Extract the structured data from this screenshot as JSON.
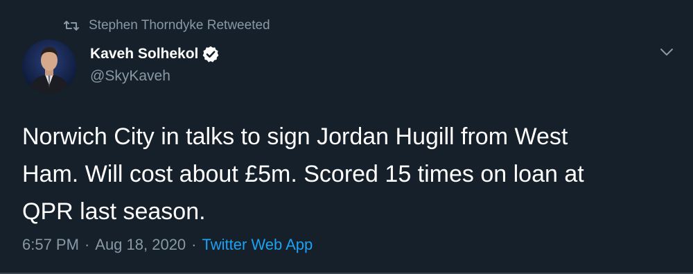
{
  "retweet": {
    "icon": "retweet-icon",
    "label": "Stephen Thorndyke Retweeted"
  },
  "author": {
    "avatar_icon": "avatar",
    "display_name": "Kaveh Solhekol",
    "verified_icon": "verified-badge-icon",
    "handle": "@SkyKaveh"
  },
  "menu": {
    "icon": "chevron-down-icon"
  },
  "tweet": {
    "lines": [
      "Norwich City in talks to sign Jordan Hugill from West",
      "Ham. Will cost about £5m. Scored 15 times on loan at",
      "QPR last season."
    ]
  },
  "meta": {
    "time": "6:57 PM",
    "separator": "·",
    "date": "Aug 18, 2020",
    "source": "Twitter Web App"
  },
  "colors": {
    "background": "#15202b",
    "secondary_text": "#8899a6",
    "link": "#1da1f2",
    "verified": "#ffffff"
  }
}
